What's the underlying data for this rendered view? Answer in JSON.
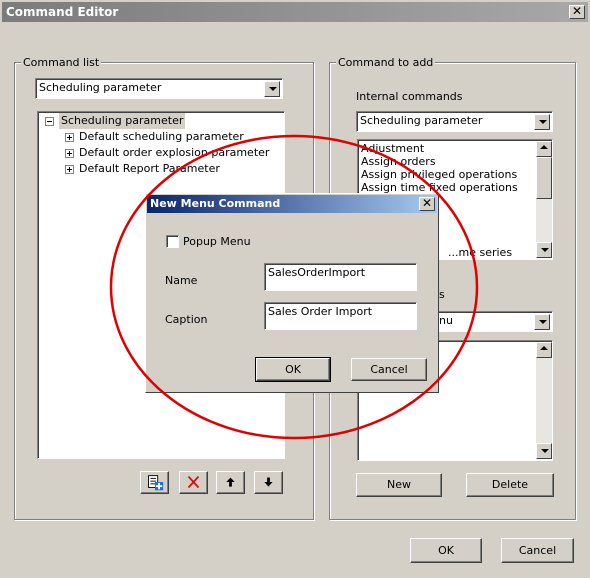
{
  "window": {
    "title": "Command Editor"
  },
  "command_list": {
    "legend": "Command list",
    "combo_value": "Scheduling parameter",
    "tree": {
      "root": "Scheduling parameter",
      "children": [
        "Default scheduling parameter",
        "Default order explosion parameter",
        "Default Report Parameter"
      ]
    }
  },
  "command_to_add": {
    "legend": "Command to add",
    "internal_label": "Internal commands",
    "internal_combo": "Scheduling parameter",
    "internal_items": [
      "Adjustment",
      "Assign orders",
      "Assign privileged operations",
      "Assign time fixed operations",
      "...me series"
    ],
    "second_label_fragment": "s",
    "second_combo_fragment": "nu",
    "new_label": "New",
    "delete_label": "Delete"
  },
  "dialog": {
    "title": "New Menu Command",
    "popup_menu_label": "Popup Menu",
    "popup_menu_checked": false,
    "name_label": "Name",
    "name_value": "SalesOrderImport",
    "caption_label": "Caption",
    "caption_value": "Sales Order Import",
    "ok_label": "OK",
    "cancel_label": "Cancel"
  },
  "footer": {
    "ok_label": "OK",
    "cancel_label": "Cancel"
  },
  "icons": {
    "close": "close-icon",
    "add_command": "add-command-icon",
    "delete": "delete-icon",
    "move_up": "arrow-up-icon",
    "move_down": "arrow-down-icon"
  },
  "colors": {
    "annotation_circle": "#e00000",
    "dialog_title": "#0a246a",
    "window_title": "#808080"
  }
}
